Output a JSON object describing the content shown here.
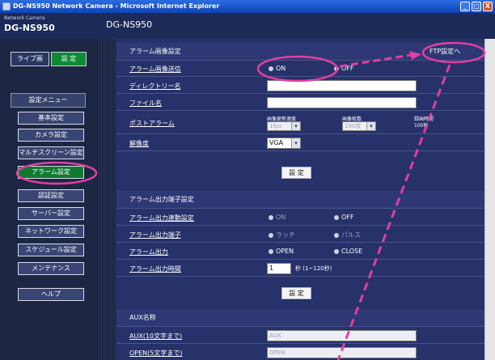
{
  "window": {
    "title": "DG-NS950 Network Camera - Microsoft Internet Explorer",
    "min": "_",
    "max": "□",
    "close": "X"
  },
  "header": {
    "brand_small": "Network Camera",
    "brand_model": "DG-NS950",
    "model": "DG-NS950"
  },
  "sidebar": {
    "live_label": "ライブ画",
    "setup_label": "設 定",
    "menu_heading": "設定メニュー",
    "items": [
      {
        "label": "基本設定"
      },
      {
        "label": "カメラ設定"
      },
      {
        "label": "マルチスクリーン設定"
      },
      {
        "label": "アラーム設定"
      },
      {
        "label": "認証設定"
      },
      {
        "label": "サーバー設定"
      },
      {
        "label": "ネットワーク設定"
      },
      {
        "label": "スケジュール設定"
      },
      {
        "label": "メンテナンス"
      }
    ],
    "help_label": "ヘルプ"
  },
  "alarm_image": {
    "heading": "アラーム画像設定",
    "ftp_link": "FTP設定へ",
    "send_label": "アラーム画像送信",
    "send_on": "ON",
    "send_off": "OFF",
    "dir_label": "ディレクトリー名",
    "file_label": "ファイル名",
    "post_label": "ポストアラーム",
    "rate_label": "画像更新速度",
    "rate_value": "1fps",
    "count_label": "画像枚数",
    "count_value": "100枚",
    "record_label": "録画時間",
    "record_value": "100秒",
    "res_label": "解像度",
    "res_value": "VGA",
    "set_button": "設 定"
  },
  "alarm_out": {
    "heading": "アラーム出力端子設定",
    "link_label": "アラーム出力連動設定",
    "link_on": "ON",
    "link_off": "OFF",
    "terminal_label": "アラーム出力端子",
    "latch": "ラッチ",
    "pulse": "パルス",
    "output_label": "アラーム出力",
    "open": "OPEN",
    "close": "CLOSE",
    "time_label": "アラーム出力時間",
    "time_value": "1",
    "time_unit": "秒 (1~120秒)",
    "set_button": "設 定"
  },
  "aux": {
    "heading": "AUX名称",
    "aux_label": "AUX(10文字まで)",
    "aux_value": "AUX",
    "open_label": "OPEN(5文字まで)",
    "open_value": "OPEN"
  },
  "colors": {
    "header": "#1b2a57",
    "main": "#27316a",
    "active": "#117a30",
    "annotation": "#e040a0"
  }
}
